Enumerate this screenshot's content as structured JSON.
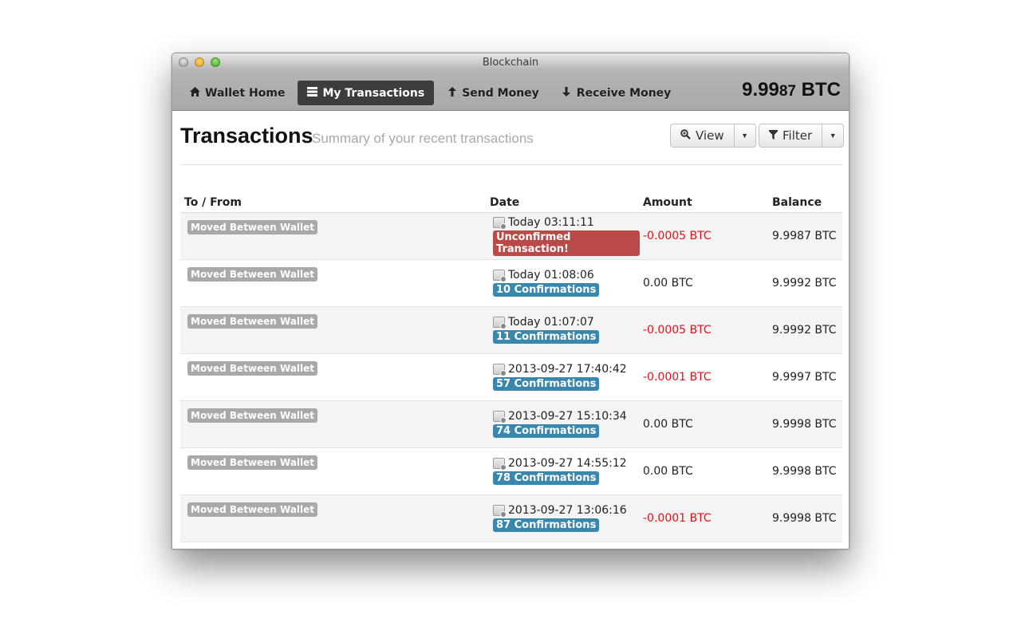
{
  "window": {
    "title": "Blockchain"
  },
  "nav": {
    "items": [
      {
        "label": "Wallet Home",
        "icon": "home-icon"
      },
      {
        "label": "My Transactions",
        "icon": "list-icon",
        "active": true
      },
      {
        "label": "Send Money",
        "icon": "arrow-up-icon"
      },
      {
        "label": "Receive Money",
        "icon": "arrow-down-icon"
      }
    ],
    "balance_main": "9.99",
    "balance_small": "87",
    "balance_unit": "BTC"
  },
  "page": {
    "title": "Transactions",
    "subtitle": "Summary of your recent transactions",
    "view_label": "View",
    "filter_label": "Filter"
  },
  "table": {
    "headers": {
      "to_from": "To / From",
      "date": "Date",
      "amount": "Amount",
      "balance": "Balance"
    },
    "rows": [
      {
        "to_from": "Moved Between Wallet",
        "date": "Today 03:11:11",
        "status": "Unconfirmed Transaction!",
        "status_color": "#b94a48",
        "amount": "-0.0005 BTC",
        "negative": true,
        "balance": "9.9987 BTC"
      },
      {
        "to_from": "Moved Between Wallet",
        "date": "Today 01:08:06",
        "status": "10 Confirmations",
        "status_color": "#3a87ad",
        "amount": "0.00 BTC",
        "negative": false,
        "balance": "9.9992 BTC"
      },
      {
        "to_from": "Moved Between Wallet",
        "date": "Today 01:07:07",
        "status": "11 Confirmations",
        "status_color": "#3a87ad",
        "amount": "-0.0005 BTC",
        "negative": true,
        "balance": "9.9992 BTC"
      },
      {
        "to_from": "Moved Between Wallet",
        "date": "2013-09-27 17:40:42",
        "status": "57 Confirmations",
        "status_color": "#3a87ad",
        "amount": "-0.0001 BTC",
        "negative": true,
        "balance": "9.9997 BTC"
      },
      {
        "to_from": "Moved Between Wallet",
        "date": "2013-09-27 15:10:34",
        "status": "74 Confirmations",
        "status_color": "#3a87ad",
        "amount": "0.00 BTC",
        "negative": false,
        "balance": "9.9998 BTC"
      },
      {
        "to_from": "Moved Between Wallet",
        "date": "2013-09-27 14:55:12",
        "status": "78 Confirmations",
        "status_color": "#3a87ad",
        "amount": "0.00 BTC",
        "negative": false,
        "balance": "9.9998 BTC"
      },
      {
        "to_from": "Moved Between Wallet",
        "date": "2013-09-27 13:06:16",
        "status": "87 Confirmations",
        "status_color": "#3a87ad",
        "amount": "-0.0001 BTC",
        "negative": true,
        "balance": "9.9998 BTC"
      }
    ]
  },
  "colors": {
    "negative_amount": "#e3111b",
    "active_nav": "#3d3d3d",
    "wallet_label": "#a9a9a9"
  }
}
